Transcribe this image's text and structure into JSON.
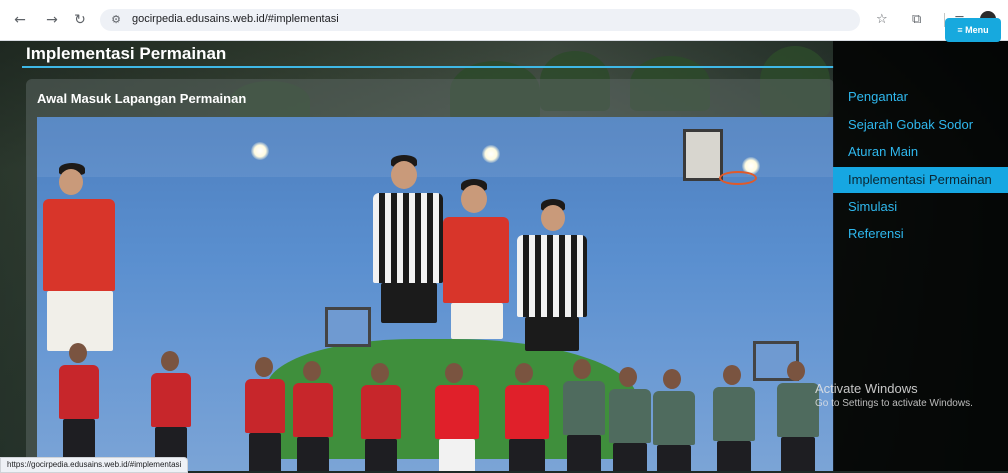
{
  "browser": {
    "url": "gocirpedia.edusains.web.id/#implementasi",
    "status_url": "https://gocirpedia.edusains.web.id/#implementasi",
    "icons": [
      "back-icon",
      "forward-icon",
      "reload-icon",
      "site-settings-icon",
      "star-icon",
      "extensions-icon",
      "tab-search-icon",
      "profile-icon"
    ]
  },
  "page": {
    "title": "Implementasi Permainan",
    "card_title": "Awal Masuk Lapangan Permainan",
    "accent_color": "#3fb8e6"
  },
  "menu": {
    "button_label": "≡ Menu",
    "items": [
      {
        "label": "Pengantar",
        "active": false
      },
      {
        "label": "Sejarah Gobak Sodor",
        "active": false
      },
      {
        "label": "Aturan Main",
        "active": false
      },
      {
        "label": "Implementasi Permainan",
        "active": true
      },
      {
        "label": "Simulasi",
        "active": false
      },
      {
        "label": "Referensi",
        "active": false
      }
    ]
  },
  "watermark": {
    "line1": "Activate Windows",
    "line2": "Go to Settings to activate Windows."
  }
}
